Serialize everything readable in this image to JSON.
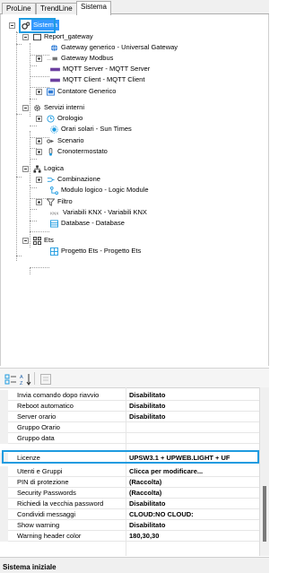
{
  "tabs": [
    {
      "label": "ProLine"
    },
    {
      "label": "TrendLine"
    },
    {
      "label": "Sistema"
    }
  ],
  "tree": {
    "root": "Sistema",
    "report_gateway": "Report_gateway",
    "gateway_generico": "Gateway generico - Universal Gateway",
    "gateway_modbus": "Gateway Modbus",
    "mqtt_server": "MQTT Server - MQTT Server",
    "mqtt_client": "MQTT Client - MQTT Client",
    "contatore": "Contatore Generico",
    "servizi_interni": "Servizi interni",
    "orologio": "Orologio",
    "orari_solari": "Orari solari - Sun Times",
    "scenario": "Scenario",
    "cronotermostato": "Cronotermostato",
    "logica": "Logica",
    "combinazione": "Combinazione",
    "modulo_logico": "Modulo logico - Logic Module",
    "filtro": "Filtro",
    "variabili_knx": "Variabili KNX - Variabili KNX",
    "database": "Database - Database",
    "ets": "Ets",
    "progetto_ets": "Progetto Ets - Progetto Ets"
  },
  "toolbar": {
    "categorized_icon": "categorized-icon",
    "sort_icon": "sort-az-icon",
    "pages_icon": "property-pages-icon"
  },
  "properties": [
    {
      "name": "Invia comando dopo riavvio",
      "value": "Disabilitato"
    },
    {
      "name": "Reboot automatico",
      "value": "Disabilitato"
    },
    {
      "name": "Server orario",
      "value": "Disabilitato"
    },
    {
      "name": "Gruppo Orario",
      "value": ""
    },
    {
      "name": "Gruppo data",
      "value": ""
    },
    {
      "name": "Licenze",
      "value": "UPSW3.1 + UPWEB.LIGHT + UF"
    },
    {
      "name": "Utenti e Gruppi",
      "value": "Clicca per modificare..."
    },
    {
      "name": "PIN di protezione",
      "value": "(Raccolta)"
    },
    {
      "name": "Security Passwords",
      "value": "(Raccolta)"
    },
    {
      "name": "Richiedi la vecchia password",
      "value": "Disabilitato"
    },
    {
      "name": "Condividi messaggi",
      "value": "CLOUD:NO CLOUD:"
    },
    {
      "name": "Show warning",
      "value": "Disabilitato"
    },
    {
      "name": "Warning header color",
      "value": "180,30,30"
    }
  ],
  "footer": {
    "title": "Sistema iniziale"
  },
  "colors": {
    "selection": "#3399ff",
    "highlight_border": "#1e9be0"
  }
}
